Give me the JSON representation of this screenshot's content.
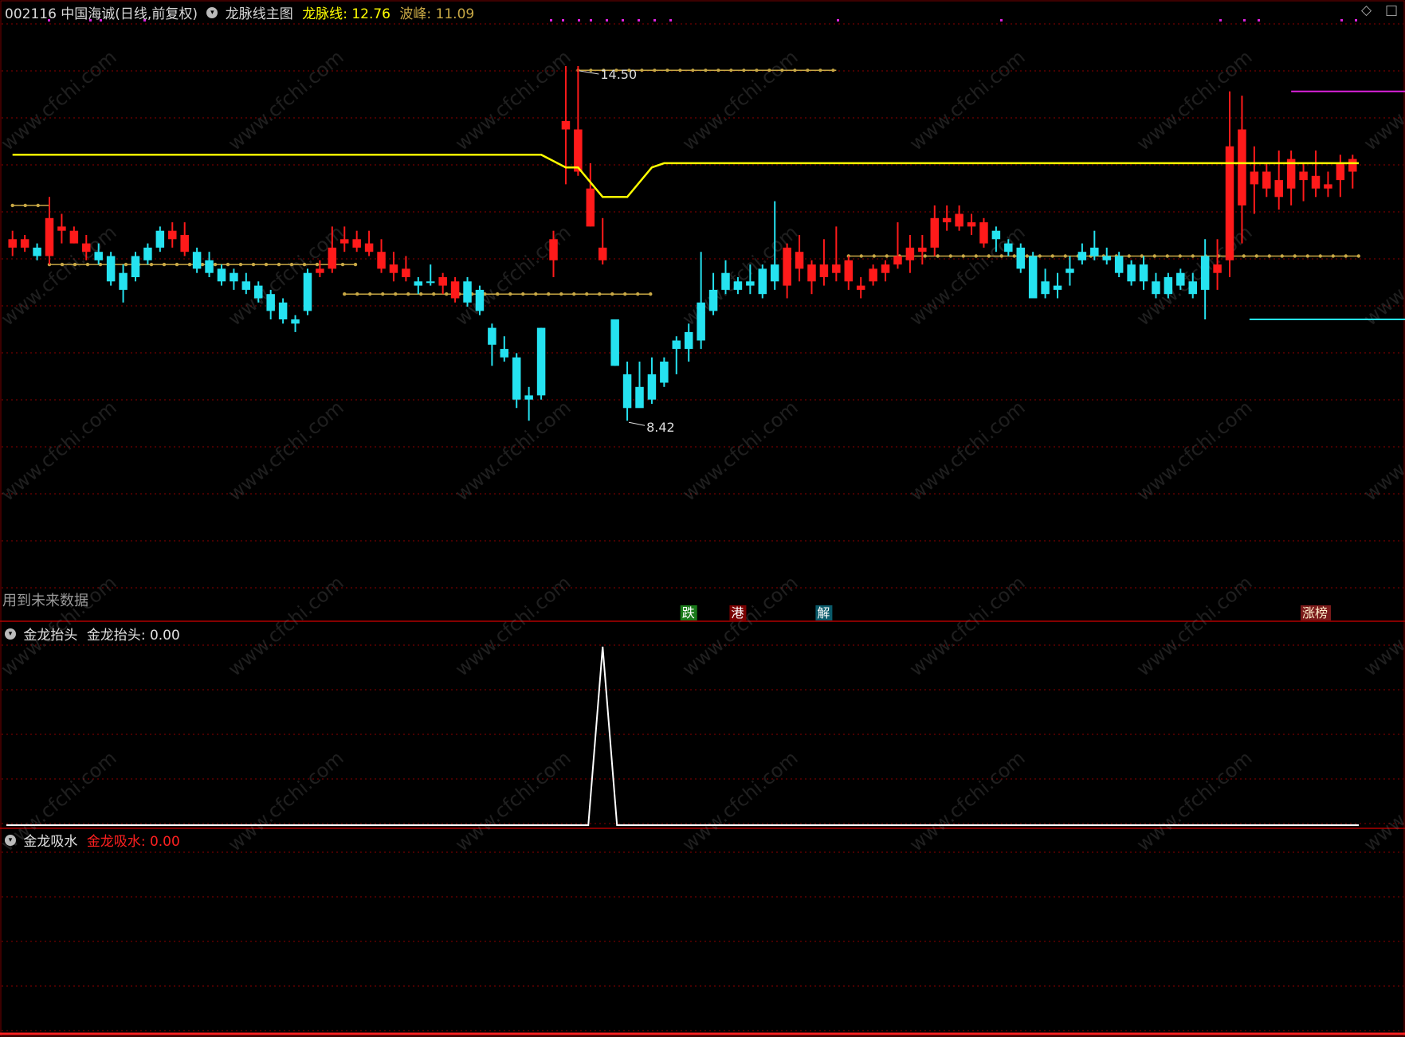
{
  "header": {
    "stock_info": "002116 中国海诚(日线,前复权)",
    "main_indicator": "龙脉线主图",
    "line_label": "龙脉线",
    "line_value": "12.76",
    "peak_label": "波峰",
    "peak_value": "11.09"
  },
  "main_panel": {
    "note": "用到未来数据",
    "high_label": "14.50",
    "low_label": "8.42",
    "signals": [
      "跌",
      "港",
      "解",
      "涨榜"
    ]
  },
  "sub_panel_1": {
    "title": "金龙抬头",
    "label": "金龙抬头",
    "value": "0.00"
  },
  "sub_panel_2": {
    "title": "金龙吸水",
    "label": "金龙吸水",
    "value": "0.00"
  },
  "watermark_text": "www.cfchi.com",
  "colors": {
    "up": "#ff1a1a",
    "down": "#25e2f0",
    "line": "#ffff00",
    "peak": "#c8a845",
    "magenta": "#dd22dd",
    "sub_line": "#ffffff",
    "grid": "#8b0000"
  },
  "chart_data": {
    "type": "candlestick",
    "ylim": [
      8.0,
      15.0
    ],
    "candles": [
      {
        "o": 12.45,
        "h": 12.55,
        "l": 12.25,
        "c": 12.35,
        "up": true
      },
      {
        "o": 12.35,
        "h": 12.5,
        "l": 12.3,
        "c": 12.45,
        "up": true
      },
      {
        "o": 12.35,
        "h": 12.4,
        "l": 12.2,
        "c": 12.25,
        "up": false
      },
      {
        "o": 12.25,
        "h": 12.95,
        "l": 12.15,
        "c": 12.7,
        "up": true
      },
      {
        "o": 12.55,
        "h": 12.75,
        "l": 12.4,
        "c": 12.6,
        "up": true
      },
      {
        "o": 12.55,
        "h": 12.6,
        "l": 12.4,
        "c": 12.4,
        "up": true
      },
      {
        "o": 12.4,
        "h": 12.5,
        "l": 12.2,
        "c": 12.3,
        "up": true
      },
      {
        "o": 12.3,
        "h": 12.4,
        "l": 12.15,
        "c": 12.2,
        "up": false
      },
      {
        "o": 12.25,
        "h": 12.3,
        "l": 11.9,
        "c": 11.95,
        "up": false
      },
      {
        "o": 12.05,
        "h": 12.15,
        "l": 11.7,
        "c": 11.85,
        "up": false
      },
      {
        "o": 12.0,
        "h": 12.3,
        "l": 11.95,
        "c": 12.25,
        "up": false
      },
      {
        "o": 12.2,
        "h": 12.4,
        "l": 12.15,
        "c": 12.35,
        "up": false
      },
      {
        "o": 12.35,
        "h": 12.6,
        "l": 12.3,
        "c": 12.55,
        "up": false
      },
      {
        "o": 12.55,
        "h": 12.65,
        "l": 12.35,
        "c": 12.45,
        "up": true
      },
      {
        "o": 12.5,
        "h": 12.65,
        "l": 12.25,
        "c": 12.3,
        "up": true
      },
      {
        "o": 12.3,
        "h": 12.35,
        "l": 12.05,
        "c": 12.1,
        "up": false
      },
      {
        "o": 12.2,
        "h": 12.3,
        "l": 12.0,
        "c": 12.05,
        "up": false
      },
      {
        "o": 12.1,
        "h": 12.15,
        "l": 11.9,
        "c": 11.95,
        "up": false
      },
      {
        "o": 12.05,
        "h": 12.1,
        "l": 11.85,
        "c": 11.95,
        "up": false
      },
      {
        "o": 11.95,
        "h": 12.05,
        "l": 11.8,
        "c": 11.85,
        "up": false
      },
      {
        "o": 11.9,
        "h": 11.95,
        "l": 11.7,
        "c": 11.75,
        "up": false
      },
      {
        "o": 11.8,
        "h": 11.85,
        "l": 11.5,
        "c": 11.6,
        "up": false
      },
      {
        "o": 11.7,
        "h": 11.75,
        "l": 11.45,
        "c": 11.5,
        "up": false
      },
      {
        "o": 11.5,
        "h": 11.55,
        "l": 11.35,
        "c": 11.45,
        "up": false
      },
      {
        "o": 11.6,
        "h": 12.1,
        "l": 11.55,
        "c": 12.05,
        "up": false
      },
      {
        "o": 12.05,
        "h": 12.2,
        "l": 12.0,
        "c": 12.1,
        "up": true
      },
      {
        "o": 12.1,
        "h": 12.6,
        "l": 12.05,
        "c": 12.35,
        "up": true
      },
      {
        "o": 12.4,
        "h": 12.6,
        "l": 12.3,
        "c": 12.45,
        "up": true
      },
      {
        "o": 12.45,
        "h": 12.55,
        "l": 12.3,
        "c": 12.35,
        "up": true
      },
      {
        "o": 12.4,
        "h": 12.55,
        "l": 12.25,
        "c": 12.3,
        "up": true
      },
      {
        "o": 12.3,
        "h": 12.45,
        "l": 12.05,
        "c": 12.1,
        "up": true
      },
      {
        "o": 12.15,
        "h": 12.3,
        "l": 11.95,
        "c": 12.05,
        "up": true
      },
      {
        "o": 12.1,
        "h": 12.25,
        "l": 11.95,
        "c": 12.0,
        "up": true
      },
      {
        "o": 11.9,
        "h": 12.0,
        "l": 11.8,
        "c": 11.95,
        "up": false
      },
      {
        "o": 11.95,
        "h": 12.15,
        "l": 11.9,
        "c": 11.95,
        "up": false
      },
      {
        "o": 12.0,
        "h": 12.05,
        "l": 11.8,
        "c": 11.9,
        "up": true
      },
      {
        "o": 11.95,
        "h": 12.0,
        "l": 11.7,
        "c": 11.75,
        "up": true
      },
      {
        "o": 11.95,
        "h": 12.0,
        "l": 11.65,
        "c": 11.7,
        "up": false
      },
      {
        "o": 11.85,
        "h": 11.9,
        "l": 11.55,
        "c": 11.6,
        "up": false
      },
      {
        "o": 11.4,
        "h": 11.45,
        "l": 10.95,
        "c": 11.2,
        "up": false
      },
      {
        "o": 11.15,
        "h": 11.3,
        "l": 11.0,
        "c": 11.05,
        "up": false
      },
      {
        "o": 11.05,
        "h": 11.1,
        "l": 10.45,
        "c": 10.55,
        "up": false
      },
      {
        "o": 10.6,
        "h": 10.7,
        "l": 10.3,
        "c": 10.55,
        "up": false
      },
      {
        "o": 10.6,
        "h": 11.4,
        "l": 10.55,
        "c": 11.4,
        "up": false
      },
      {
        "o": 12.45,
        "h": 12.55,
        "l": 12.0,
        "c": 12.2,
        "up": true
      },
      {
        "o": 13.85,
        "h": 14.5,
        "l": 13.1,
        "c": 13.75,
        "up": true
      },
      {
        "o": 13.75,
        "h": 14.5,
        "l": 13.2,
        "c": 13.25,
        "up": true
      },
      {
        "o": 13.05,
        "h": 13.35,
        "l": 12.6,
        "c": 12.6,
        "up": true
      },
      {
        "o": 12.35,
        "h": 12.7,
        "l": 12.15,
        "c": 12.2,
        "up": true
      },
      {
        "o": 11.5,
        "h": 11.5,
        "l": 10.95,
        "c": 10.95,
        "up": false
      },
      {
        "o": 10.85,
        "h": 11.0,
        "l": 10.3,
        "c": 10.45,
        "up": false
      },
      {
        "o": 10.7,
        "h": 11.0,
        "l": 10.6,
        "c": 10.45,
        "up": false
      },
      {
        "o": 10.85,
        "h": 11.05,
        "l": 10.5,
        "c": 10.55,
        "up": false
      },
      {
        "o": 10.75,
        "h": 11.05,
        "l": 10.7,
        "c": 11.0,
        "up": false
      },
      {
        "o": 11.15,
        "h": 11.3,
        "l": 10.85,
        "c": 11.25,
        "up": false
      },
      {
        "o": 11.35,
        "h": 11.45,
        "l": 11.0,
        "c": 11.15,
        "up": false
      },
      {
        "o": 11.7,
        "h": 12.3,
        "l": 11.15,
        "c": 11.25,
        "up": false
      },
      {
        "o": 11.6,
        "h": 12.05,
        "l": 11.55,
        "c": 11.85,
        "up": false
      },
      {
        "o": 11.85,
        "h": 12.2,
        "l": 11.8,
        "c": 12.05,
        "up": false
      },
      {
        "o": 11.85,
        "h": 12.0,
        "l": 11.8,
        "c": 11.95,
        "up": false
      },
      {
        "o": 11.9,
        "h": 12.15,
        "l": 11.8,
        "c": 11.95,
        "up": false
      },
      {
        "o": 12.1,
        "h": 12.15,
        "l": 11.75,
        "c": 11.8,
        "up": false
      },
      {
        "o": 12.15,
        "h": 12.9,
        "l": 11.85,
        "c": 11.95,
        "up": false
      },
      {
        "o": 11.9,
        "h": 12.4,
        "l": 11.75,
        "c": 12.35,
        "up": true
      },
      {
        "o": 12.3,
        "h": 12.5,
        "l": 11.95,
        "c": 12.1,
        "up": true
      },
      {
        "o": 11.95,
        "h": 12.2,
        "l": 11.8,
        "c": 12.15,
        "up": true
      },
      {
        "o": 12.15,
        "h": 12.45,
        "l": 11.9,
        "c": 12.0,
        "up": true
      },
      {
        "o": 12.15,
        "h": 12.6,
        "l": 11.95,
        "c": 12.05,
        "up": true
      },
      {
        "o": 12.2,
        "h": 12.25,
        "l": 11.85,
        "c": 11.95,
        "up": true
      },
      {
        "o": 11.9,
        "h": 12.0,
        "l": 11.75,
        "c": 11.85,
        "up": true
      },
      {
        "o": 11.95,
        "h": 12.15,
        "l": 11.9,
        "c": 12.1,
        "up": true
      },
      {
        "o": 12.05,
        "h": 12.2,
        "l": 11.95,
        "c": 12.15,
        "up": true
      },
      {
        "o": 12.15,
        "h": 12.65,
        "l": 12.1,
        "c": 12.25,
        "up": true
      },
      {
        "o": 12.2,
        "h": 12.5,
        "l": 12.05,
        "c": 12.35,
        "up": true
      },
      {
        "o": 12.35,
        "h": 12.5,
        "l": 12.15,
        "c": 12.3,
        "up": true
      },
      {
        "o": 12.35,
        "h": 12.85,
        "l": 12.25,
        "c": 12.7,
        "up": true
      },
      {
        "o": 12.65,
        "h": 12.85,
        "l": 12.55,
        "c": 12.7,
        "up": true
      },
      {
        "o": 12.75,
        "h": 12.85,
        "l": 12.55,
        "c": 12.6,
        "up": true
      },
      {
        "o": 12.6,
        "h": 12.75,
        "l": 12.5,
        "c": 12.65,
        "up": true
      },
      {
        "o": 12.65,
        "h": 12.7,
        "l": 12.35,
        "c": 12.4,
        "up": true
      },
      {
        "o": 12.55,
        "h": 12.6,
        "l": 12.3,
        "c": 12.45,
        "up": false
      },
      {
        "o": 12.4,
        "h": 12.45,
        "l": 12.25,
        "c": 12.3,
        "up": false
      },
      {
        "o": 12.35,
        "h": 12.4,
        "l": 12.05,
        "c": 12.1,
        "up": false
      },
      {
        "o": 12.25,
        "h": 12.3,
        "l": 11.75,
        "c": 11.75,
        "up": false
      },
      {
        "o": 11.95,
        "h": 12.1,
        "l": 11.75,
        "c": 11.8,
        "up": false
      },
      {
        "o": 11.9,
        "h": 12.05,
        "l": 11.75,
        "c": 11.85,
        "up": false
      },
      {
        "o": 12.1,
        "h": 12.25,
        "l": 11.9,
        "c": 12.05,
        "up": false
      },
      {
        "o": 12.3,
        "h": 12.4,
        "l": 12.15,
        "c": 12.2,
        "up": false
      },
      {
        "o": 12.25,
        "h": 12.55,
        "l": 12.2,
        "c": 12.35,
        "up": false
      },
      {
        "o": 12.25,
        "h": 12.35,
        "l": 12.15,
        "c": 12.2,
        "up": false
      },
      {
        "o": 12.25,
        "h": 12.3,
        "l": 12.0,
        "c": 12.05,
        "up": false
      },
      {
        "o": 12.15,
        "h": 12.2,
        "l": 11.9,
        "c": 11.95,
        "up": false
      },
      {
        "o": 12.15,
        "h": 12.25,
        "l": 11.85,
        "c": 11.95,
        "up": false
      },
      {
        "o": 11.95,
        "h": 12.05,
        "l": 11.75,
        "c": 11.8,
        "up": false
      },
      {
        "o": 12.0,
        "h": 12.05,
        "l": 11.75,
        "c": 11.8,
        "up": false
      },
      {
        "o": 11.9,
        "h": 12.1,
        "l": 11.85,
        "c": 12.05,
        "up": false
      },
      {
        "o": 11.95,
        "h": 12.05,
        "l": 11.75,
        "c": 11.8,
        "up": false
      },
      {
        "o": 11.85,
        "h": 12.45,
        "l": 11.5,
        "c": 12.25,
        "up": false
      },
      {
        "o": 12.05,
        "h": 12.45,
        "l": 11.85,
        "c": 12.15,
        "up": true
      },
      {
        "o": 12.2,
        "h": 14.2,
        "l": 12.0,
        "c": 13.55,
        "up": true
      },
      {
        "o": 13.75,
        "h": 14.15,
        "l": 12.4,
        "c": 12.85,
        "up": true
      },
      {
        "o": 13.25,
        "h": 13.55,
        "l": 12.75,
        "c": 13.1,
        "up": true
      },
      {
        "o": 13.25,
        "h": 13.35,
        "l": 12.95,
        "c": 13.05,
        "up": true
      },
      {
        "o": 13.15,
        "h": 13.5,
        "l": 12.8,
        "c": 12.95,
        "up": true
      },
      {
        "o": 13.4,
        "h": 13.5,
        "l": 12.85,
        "c": 13.05,
        "up": true
      },
      {
        "o": 13.25,
        "h": 13.35,
        "l": 12.9,
        "c": 13.15,
        "up": true
      },
      {
        "o": 13.2,
        "h": 13.5,
        "l": 12.95,
        "c": 13.05,
        "up": true
      },
      {
        "o": 13.1,
        "h": 13.25,
        "l": 12.95,
        "c": 13.05,
        "up": true
      },
      {
        "o": 13.15,
        "h": 13.45,
        "l": 12.95,
        "c": 13.35,
        "up": true
      },
      {
        "o": 13.4,
        "h": 13.45,
        "l": 13.05,
        "c": 13.25,
        "up": true
      }
    ],
    "dragon_line": [
      {
        "i": 0,
        "v": 13.45
      },
      {
        "i": 43,
        "v": 13.45
      },
      {
        "i": 45,
        "v": 13.3
      },
      {
        "i": 46,
        "v": 13.3
      },
      {
        "i": 48,
        "v": 12.95
      },
      {
        "i": 50,
        "v": 12.95
      },
      {
        "i": 52,
        "v": 13.3
      },
      {
        "i": 53,
        "v": 13.35
      },
      {
        "i": 115,
        "v": 13.35
      }
    ],
    "peak_segments": [
      {
        "from": 0,
        "to": 3,
        "v": 12.85
      },
      {
        "from": 3,
        "to": 28,
        "v": 12.15
      },
      {
        "from": 27,
        "to": 52,
        "v": 11.8
      },
      {
        "from": 68,
        "to": 115,
        "v": 12.25
      }
    ],
    "sub1_spike": {
      "i": 48,
      "v": 1.0
    },
    "signal_positions": [
      55,
      59,
      66,
      106
    ]
  }
}
